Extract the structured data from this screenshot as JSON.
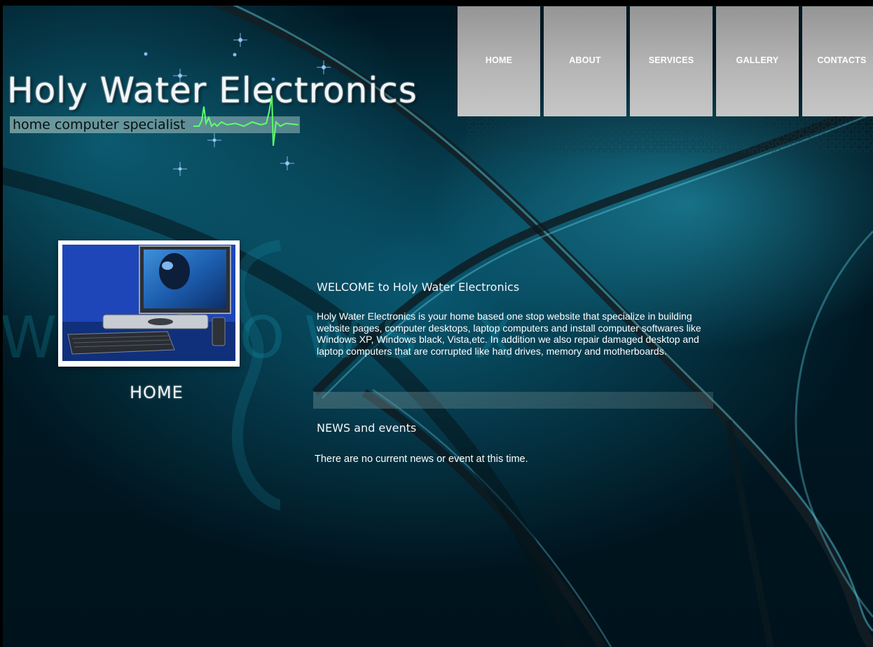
{
  "site": {
    "title": "Holy Water Electronics",
    "tagline": "home computer specialist"
  },
  "nav": {
    "items": [
      {
        "label": "HOME"
      },
      {
        "label": "ABOUT"
      },
      {
        "label": "SERVICES"
      },
      {
        "label": "GALLERY"
      },
      {
        "label": "CONTACTS"
      }
    ]
  },
  "sidebar": {
    "page_heading": "HOME"
  },
  "main": {
    "welcome_title": "WELCOME to Holy Water Electronics",
    "welcome_text": "Holy Water Electronics is your home based one stop website that specialize in building website pages, computer desktops, laptop computers and install computer softwares like Windows XP, Windows black, Vista,etc. In addition we also repair damaged desktop and laptop computers that are corrupted like hard drives, memory and motherboards.",
    "news_title": "NEWS and events",
    "news_text": "There are no current news or event at this time."
  },
  "colors": {
    "background": "#035466",
    "nav_button": "#b5b5b5",
    "text": "#ffffff",
    "pulse": "#5dff6a"
  }
}
